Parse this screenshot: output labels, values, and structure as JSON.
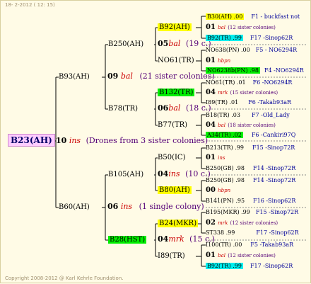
{
  "header": {
    "date": "18-  2-2012 ( 12: 15)"
  },
  "footer": "Copyright 2008-2012 @ Karl Kehrle Foundation.",
  "root": {
    "name": "B23(AH)",
    "gen": "10",
    "bee": "ins",
    "note": "(Drones from 3 sister colonies)"
  },
  "l1": [
    {
      "name": "B93(AH)",
      "gen": "09",
      "bee": "bal",
      "note": "(21 sister colonies)"
    },
    {
      "name": "B60(AH)",
      "gen": "06",
      "bee": "ins",
      "note": "(1 single colony)"
    }
  ],
  "l2": [
    {
      "name": "B250(AH)",
      "gen": "05",
      "bee": "bal",
      "note": "(19 c.)"
    },
    {
      "name": "B78(TR)",
      "gen": "06",
      "bee": "bal",
      "note": "(18 c.)"
    },
    {
      "name": "B105(AH)",
      "gen": "04",
      "bee": "ins",
      "note": "(10 c.)"
    },
    {
      "name": "B28(HST)",
      "gen": "04",
      "bee": "mrk",
      "note": "(15 c.)"
    }
  ],
  "l3": [
    {
      "name": "B92(AH)"
    },
    {
      "name": "NO61(TR)"
    },
    {
      "name": "B132(TR)"
    },
    {
      "name": "B77(TR)"
    },
    {
      "name": "B50(IC)"
    },
    {
      "name": "B80(AH)"
    },
    {
      "name": "B24(MKR)"
    },
    {
      "name": "I89(TR)"
    }
  ],
  "l4": [
    {
      "top": "B30(AH) .00",
      "top_id": "F1 - buckfast not",
      "gen": "01",
      "bee": "bal",
      "note": "(12 sister colonies)",
      "bottom": "B92(TR) .99",
      "bottom_id": "F17 -Sinop62R"
    },
    {
      "top": "NO638(PN) .00",
      "top_id": "F5 - NO6294R",
      "gen": "01",
      "bee": "hbpn",
      "note": "",
      "bottom": "NO6238b(PN) .98",
      "bottom_id": "F4 -NO6294R"
    },
    {
      "top": "NO61(TR) .01",
      "top_id": "F6 -NO6294R",
      "gen": "04",
      "bee": "mrk",
      "note": "(15 sister colonies)",
      "bottom": "I89(TR) .01",
      "bottom_id": "F6 -Takab93aR"
    },
    {
      "top": "B18(TR) .03",
      "top_id": "F7 -Old_Lady",
      "gen": "04",
      "bee": "bal",
      "note": "(18 sister colonies)",
      "bottom": "A34(TR) .02",
      "bottom_id": "F6 -Cankiri97Q"
    },
    {
      "top": "B213(TR) .99",
      "top_id": "F15 -Sinop72R",
      "gen": "01",
      "bee": "ins",
      "note": "",
      "bottom": "B250(GB) .98",
      "bottom_id": "F14 -Sinop72R"
    },
    {
      "top": "B250(GB) .98",
      "top_id": "F14 -Sinop72R",
      "gen": "00",
      "bee": "hbpn",
      "note": "",
      "bottom": "B141(PN) .95",
      "bottom_id": "F16 -Sinop62R"
    },
    {
      "top": "B195(MKR) .99",
      "top_id": "F15 -Sinop72R",
      "gen": "02",
      "bee": "mrk",
      "note": "(12 sister colonies)",
      "bottom": "ST338 .99",
      "bottom_id": "F17 -Sinop62R"
    },
    {
      "top": "I100(TR) .00",
      "top_id": "F5 -Takab93aR",
      "gen": "01",
      "bee": "bal",
      "note": "(12 sister colonies)",
      "bottom": "B92(TR) .99",
      "bottom_id": "F17 -Sinop62R"
    }
  ],
  "colors": {
    "yellow": "#ffff00",
    "green": "#00ee00",
    "cyan": "#00eeee",
    "pink": "#ffccff",
    "background": "#fffbe6"
  }
}
